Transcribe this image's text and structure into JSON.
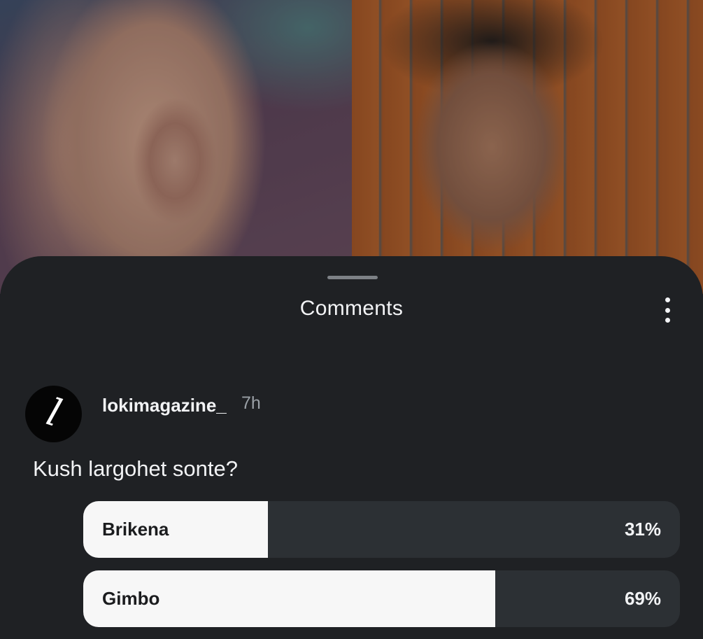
{
  "sheet": {
    "title": "Comments"
  },
  "comment": {
    "username": "lokimagazine_",
    "timestamp": "7h",
    "text": "Kush largohet sonte?",
    "avatar_letter": "l"
  },
  "poll": {
    "options": [
      {
        "label": "Brikena",
        "percent_text": "31%",
        "percent": 31
      },
      {
        "label": "Gimbo",
        "percent_text": "69%",
        "percent": 69
      }
    ]
  },
  "colors": {
    "sheet_background": "#1f2124",
    "poll_fill": "#f7f7f7",
    "poll_track": "#2c3034"
  },
  "icons": {
    "more": "more-vertical-icon"
  }
}
